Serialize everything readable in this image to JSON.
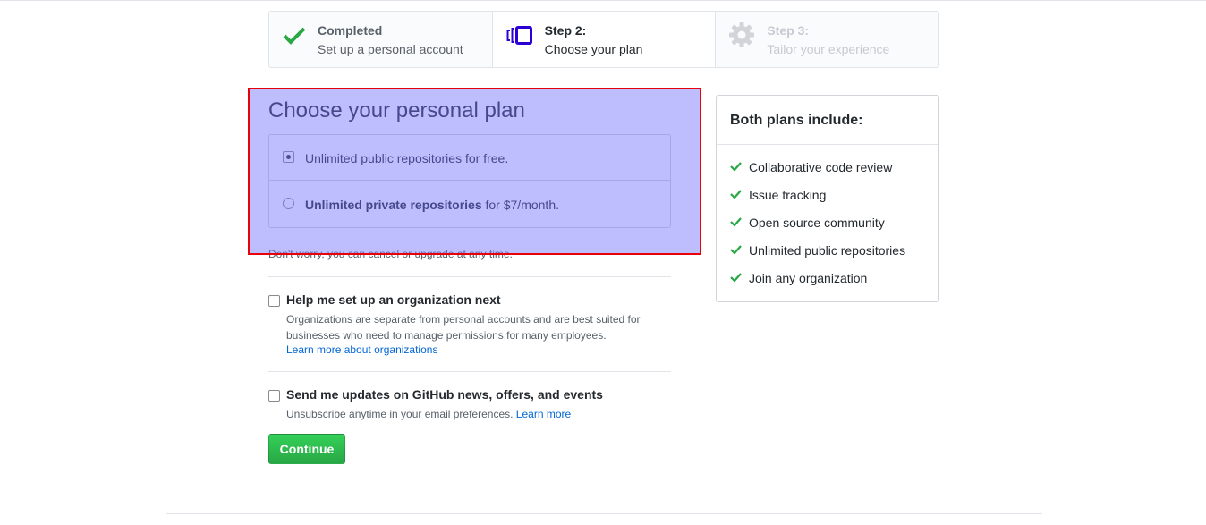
{
  "steps": [
    {
      "title": "Completed",
      "subtitle": "Set up a personal account",
      "icon": "checkmark-icon",
      "state": "completed"
    },
    {
      "title": "Step 2:",
      "subtitle": "Choose your plan",
      "icon": "plan-cards-icon",
      "state": "current"
    },
    {
      "title": "Step 3:",
      "subtitle": "Tailor your experience",
      "icon": "gear-icon",
      "state": "upcoming"
    }
  ],
  "plan": {
    "heading": "Choose your personal plan",
    "options": [
      {
        "text": "Unlimited public repositories for free.",
        "selected": true
      },
      {
        "bold": "Unlimited private repositories",
        "rest": " for $7/month.",
        "selected": false
      }
    ],
    "note": "Don't worry, you can cancel or upgrade at any time."
  },
  "org_option": {
    "title": "Help me set up an organization next",
    "description": "Organizations are separate from personal accounts and are best suited for businesses who need to manage permissions for many employees.",
    "link": "Learn more about organizations",
    "checked": false
  },
  "updates_option": {
    "title": "Send me updates on GitHub news, offers, and events",
    "description": "Unsubscribe anytime in your email preferences.",
    "link": "Learn more",
    "checked": false
  },
  "continue_label": "Continue",
  "side": {
    "title": "Both plans include:",
    "items": [
      "Collaborative code review",
      "Issue tracking",
      "Open source community",
      "Unlimited public repositories",
      "Join any organization"
    ]
  },
  "colors": {
    "check_green": "#28a745",
    "accent_blue": "#0366d6",
    "step_icon_purple": "#2c00d4",
    "highlight_fill": "#6e6eff",
    "highlight_border": "#e8000b"
  }
}
